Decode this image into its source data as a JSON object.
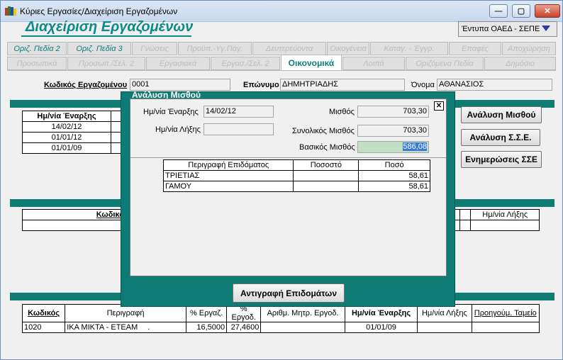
{
  "window": {
    "title": "Κύριες Εργασίες/Διαχείριση Εργαζομένων",
    "minimize": "—",
    "maximize": "▢",
    "close": "✕"
  },
  "header": {
    "title": "Διαχείριση Εργαζομένων",
    "forms_label": "Έντυπα ΟΑΕΔ - ΣΕΠΕ"
  },
  "tabs_row1": [
    "Οριζ. Πεδία 2",
    "Οριζ. Πεδία 3",
    "Γνώσεις",
    "Προϋπ.-Υγ.Πάγ.",
    "Δευτερεύοντα",
    "Οικογένεια",
    "Καταγ. - Έγγρ.",
    "Επαφές",
    "Αποχώρηση"
  ],
  "tabs_row2": [
    "Προσωπικά",
    "Προσωπ./Σελ. 2",
    "Εργασιακά",
    "Εργασ./Σελ. 2",
    "Οικονομικά",
    "Λοιπά",
    "Οριζόμενα Πεδία",
    "Δημόσιο"
  ],
  "employee": {
    "code_label": "Κωδικός Εργαζομένου",
    "code": "0001",
    "surname_label": "Επώνυμο",
    "surname": "ΔΗΜΗΤΡΙΑΔΗΣ",
    "name_label": "Όνομα",
    "name": "ΑΘΑΝΑΣΙΟΣ"
  },
  "start_table": {
    "header": "Ημ/νία Έναρξης",
    "rows": [
      "14/02/12",
      "01/01/12",
      "01/01/09"
    ]
  },
  "side_buttons": {
    "salary": "Ανάλυση Μισθού",
    "sse": "Ανάλυση Σ.Σ.Ε.",
    "updates": "Ενημερώσεις ΣΣΕ"
  },
  "mid_table": {
    "code": "Κωδικός",
    "end": "Ημ/νία Λήξης"
  },
  "bottom_table": {
    "headers": [
      "Κωδικός",
      "Περιγραφή",
      "% Εργαζ.",
      "% Εργοδ.",
      "Αριθμ. Μητρ. Εργοδ.",
      "Ημ/νία Έναρξης",
      "Ημ/νία Λήξης",
      "Προηγούμ. Ταμείο"
    ],
    "row": [
      "1020",
      "ΙΚΑ ΜΙΚΤΑ - ΕΤΕΑΜ",
      "16,5000",
      "27,4600",
      "",
      "01/01/09",
      "",
      ""
    ],
    "row_dot": "."
  },
  "modal": {
    "title": "Ανάλυση Μισθού",
    "close": "✕",
    "start_label": "Ημ/νία Έναρξης",
    "start": "14/02/12",
    "end_label": "Ημ/νία Λήξης",
    "end": "",
    "salary_label": "Μισθός",
    "salary": "703,30",
    "total_label": "Συνολικός Μισθός",
    "total": "703,30",
    "base_label": "Βασικός Μισθός",
    "base": "586,08",
    "allow_headers": [
      "Περιγραφή Επιδόματος",
      "Ποσοστό",
      "Ποσό"
    ],
    "allowances": [
      {
        "desc": "ΤΡΙΕΤΙΑΣ",
        "pct": "",
        "amount": "58,61"
      },
      {
        "desc": "ΓΑΜΟΥ",
        "pct": "",
        "amount": "58,61"
      }
    ],
    "copy_button": "Αντιγραφή Επιδομάτων"
  }
}
